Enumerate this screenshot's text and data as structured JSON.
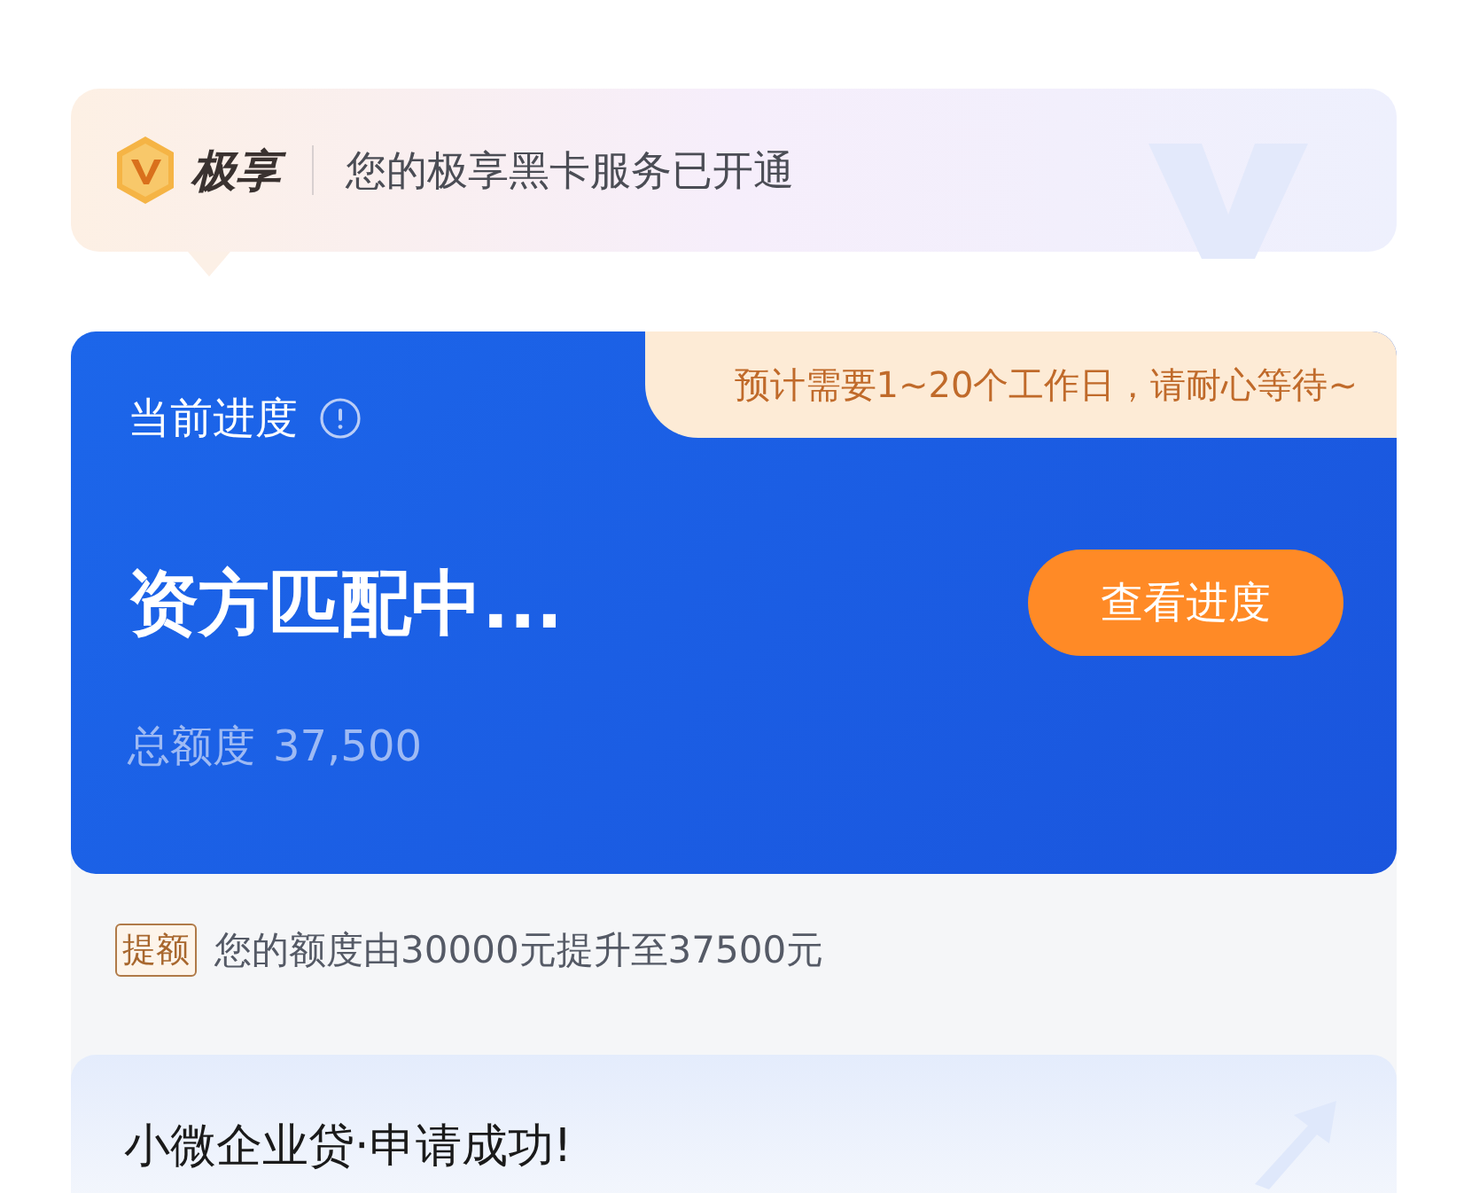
{
  "banner": {
    "brand": "极享",
    "message": "您的极享黑卡服务已开通"
  },
  "progress_card": {
    "label": "当前进度",
    "estimate": "预计需要1~20个工作日，请耐心等待~",
    "status": "资方匹配中...",
    "button": "查看进度",
    "limit_label": "总额度",
    "limit_value": "37,500"
  },
  "notice": {
    "tag": "提额",
    "text": "您的额度由30000元提升至37500元"
  },
  "result_card": {
    "title": "小微企业贷·申请成功!"
  }
}
